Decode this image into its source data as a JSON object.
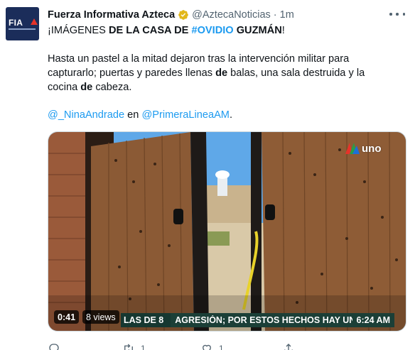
{
  "tweet": {
    "author_name": "Fuerza Informativa Azteca",
    "avatar_text": "FIA",
    "handle": "@AztecaNoticias",
    "separator": "·",
    "time": "1m",
    "headline_parts": [
      "¡IMÁGENES ",
      "DE LA CASA DE ",
      "#OVIDIO",
      " GUZMÁN",
      "!"
    ],
    "body_line1": "Hasta un pastel a la mitad dejaron tras la intervención militar para",
    "body_line2_a": "capturarlo; puertas y paredes llenas ",
    "body_line2_b": "de",
    "body_line2_c": " balas, una sala destruida y la",
    "body_line3_a": "cocina ",
    "body_line3_b": "de",
    "body_line3_c": " cabeza.",
    "mention_a": "@_NinaAndrade",
    "mention_mid": " en ",
    "mention_b": "@PrimeraLineaAM",
    "mention_end": "."
  },
  "video": {
    "duration": "0:41",
    "views": "8 views",
    "channel_logo": "uno",
    "ticker_segment": "LAS DE 8",
    "ticker_text": "AGRESIÓN; POR ESTOS HECHOS HAY UNA PERSONA DE",
    "ticker_clock": "6:24 AM"
  },
  "actions": {
    "reply_count": "",
    "retweet_count": "1",
    "like_count": "1",
    "share_count": ""
  },
  "colors": {
    "link": "#1d9bf0",
    "secondary_text": "#536471",
    "verified_gold": "#e2b719"
  }
}
